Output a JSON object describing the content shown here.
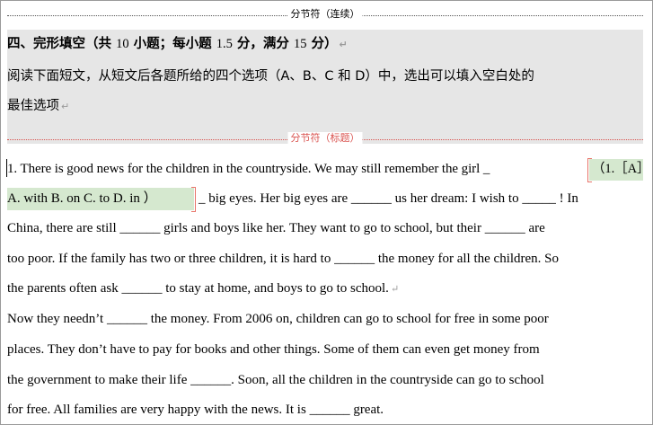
{
  "section_break_continuous": "分节符（连续）",
  "section_break_title": "分节符（标题）",
  "heading": {
    "text_prefix": "四、完形填空（共",
    "num_items": "10",
    "text_mid1": "小题；每小题",
    "points_each": "1.5",
    "text_mid2": "分，满分",
    "total_points": "15",
    "text_suffix": "分）"
  },
  "instruction": {
    "line1": "阅读下面短文，从短文后各题所给的四个选项（A、B、C 和 D）中，选出可以填入空白处的",
    "line2": "最佳选项"
  },
  "content_control": {
    "q1": "（1.［A］",
    "options": "A. with  B. on  C. to  D. in  ）"
  },
  "passage": {
    "p1_line1_a": "1.   There is good news for the children in the countryside. We may still remember the girl _",
    "p1_line2_b": "_ big eyes. Her big eyes are ______ us her dream: I wish to _____ ! In",
    "p1_line3": "China, there are still ______ girls and boys like her. They want to go to school, but their ______ are",
    "p1_line4": "too poor. If the family has two or three children, it is hard to ______ the money for all the children. So",
    "p1_line5": "the parents often ask ______ to stay at home, and boys to go to school.",
    "p2_line1": "Now they needn’t ______ the money. From 2006 on, children can go to school for free in some poor",
    "p2_line2": "places. They don’t have to pay for books and other things. Some of them can even get money from",
    "p2_line3": "the government to make their life ______. Soon, all the children in the countryside can go to school",
    "p2_line4": "for free. All families are very happy with the news. It is ______ great."
  },
  "paragraph_mark": "↵",
  "colors": {
    "shading": "#e6e6e6",
    "content_control_bg": "#d5e8cf",
    "bracket": "#e8746a",
    "section_break_title": "#d9534f"
  }
}
